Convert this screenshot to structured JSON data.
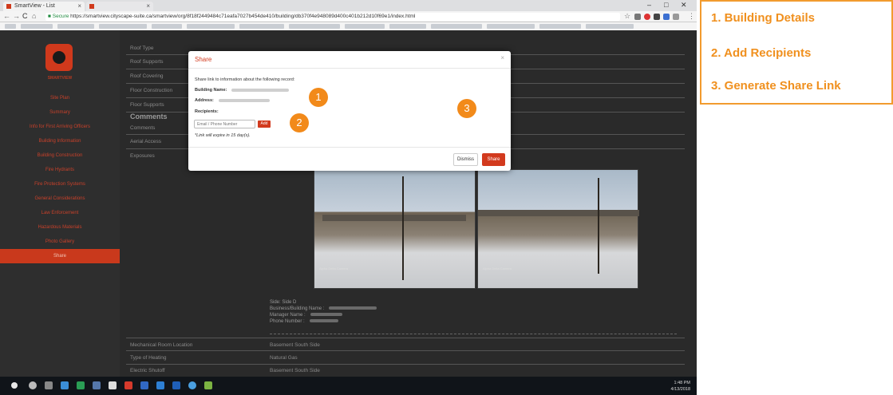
{
  "browser": {
    "tabs": [
      {
        "label": "SmartView - List"
      },
      {
        "label": ""
      }
    ],
    "address": {
      "secure_label": "Secure",
      "url": "https://smartview.cityscape-suite.ca/smartview/org/8f18f2449484c71eafa7027b454de410/building/db370f4e948089d400c401b212d10f69e1/index.html"
    },
    "window_controls": [
      "–",
      "□",
      "✕"
    ]
  },
  "app": {
    "brand": "SMARTVIEW",
    "sidebar": {
      "items": [
        {
          "label": "Site Plan"
        },
        {
          "label": "Summary"
        },
        {
          "label": "Info for First Arriving Officers"
        },
        {
          "label": "Building Information"
        },
        {
          "label": "Building Construction"
        },
        {
          "label": "Fire Hydrants"
        },
        {
          "label": "Fire Protection Systems"
        },
        {
          "label": "General Considerations"
        },
        {
          "label": "Law Enforcement"
        },
        {
          "label": "Hazardous Materials"
        },
        {
          "label": "Photo Gallery"
        },
        {
          "label": "Share",
          "active": true
        }
      ]
    },
    "rows_top": [
      {
        "label": "Roof Type"
      },
      {
        "label": "Roof Supports"
      },
      {
        "label": "Roof Covering"
      },
      {
        "label": "Floor Construction"
      },
      {
        "label": "Floor Supports"
      }
    ],
    "comments_heading": "Comments",
    "rows_mid": [
      {
        "label": "Comments"
      },
      {
        "label": "Aerial Access"
      },
      {
        "label": "Exposures"
      }
    ],
    "photos": [
      {
        "caption": "Alpha Delta Camera"
      },
      {
        "caption": "Alpha Delta Camera"
      }
    ],
    "exposure_info": {
      "side": "Side:  Side D",
      "business": "Business/Building Name :",
      "manager": "Manager Name :",
      "phone": "Phone Number :"
    },
    "rows_bottom": [
      {
        "label": "Mechanical Room Location",
        "value": "Basement South Side"
      },
      {
        "label": "Type of Heating",
        "value": "Natural Gas"
      },
      {
        "label": "Electric Shutoff",
        "value": "Basement South Side"
      }
    ]
  },
  "modal": {
    "title": "Share",
    "close_glyph": "×",
    "intro": "Share link to information about the following record:",
    "building_name_label": "Building Name:",
    "address_label": "Address:",
    "recipients_label": "Recipients:",
    "recipient_placeholder": "Email / Phone Number",
    "add_label": "Add",
    "expiry_note": "*Link will expire in 15 day(s).",
    "dismiss_label": "Dismiss",
    "share_label": "Share"
  },
  "badges": [
    "1",
    "2",
    "3"
  ],
  "taskbar": {
    "time": "1:48 PM",
    "date": "4/13/2018"
  },
  "legend": {
    "items": [
      "1. Building Details",
      "2. Add Recipients",
      "3. Generate Share Link"
    ]
  },
  "colors": {
    "accent": "#d23a1e",
    "badge": "#f28a1a",
    "legend_border": "#f29b2e"
  }
}
